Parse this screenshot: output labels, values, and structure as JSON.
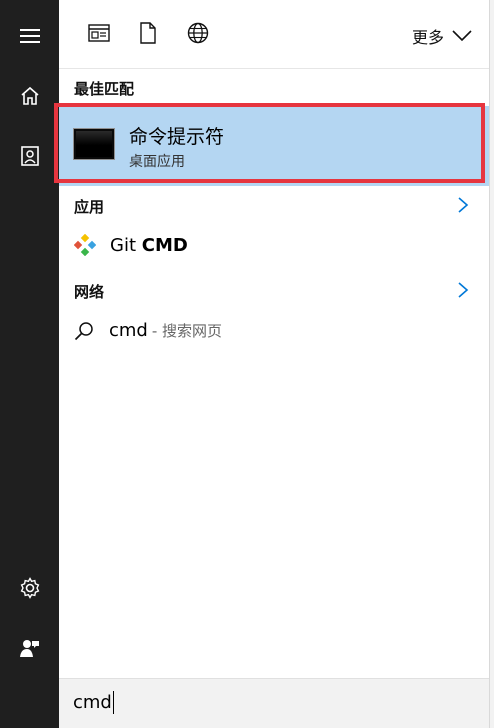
{
  "rail": {
    "items": [
      {
        "icon": "hamburger-icon"
      },
      {
        "icon": "home-icon"
      },
      {
        "icon": "document-icon"
      },
      {
        "icon": "settings-icon"
      },
      {
        "icon": "feedback-icon"
      }
    ]
  },
  "toolbar": {
    "filters": [
      {
        "icon": "apps-filter-icon"
      },
      {
        "icon": "documents-filter-icon"
      },
      {
        "icon": "web-filter-icon"
      }
    ],
    "more_label": "更多"
  },
  "results": {
    "best_match_label": "最佳匹配",
    "best_match": {
      "title": "命令提示符",
      "subtitle": "桌面应用",
      "icon": "command-prompt-icon"
    },
    "apps_label": "应用",
    "apps": [
      {
        "name_prefix": "Git ",
        "name_bold": "CMD",
        "icon": "git-icon"
      }
    ],
    "web_label": "网络",
    "web": [
      {
        "query": "cmd",
        "hint": "- 搜索网页",
        "icon": "search-icon"
      }
    ]
  },
  "search": {
    "value": "cmd"
  },
  "colors": {
    "rail": "#1f1f1f",
    "selected": "#b4d6f2",
    "highlight_frame": "#e6353f",
    "accent": "#0078d7"
  }
}
